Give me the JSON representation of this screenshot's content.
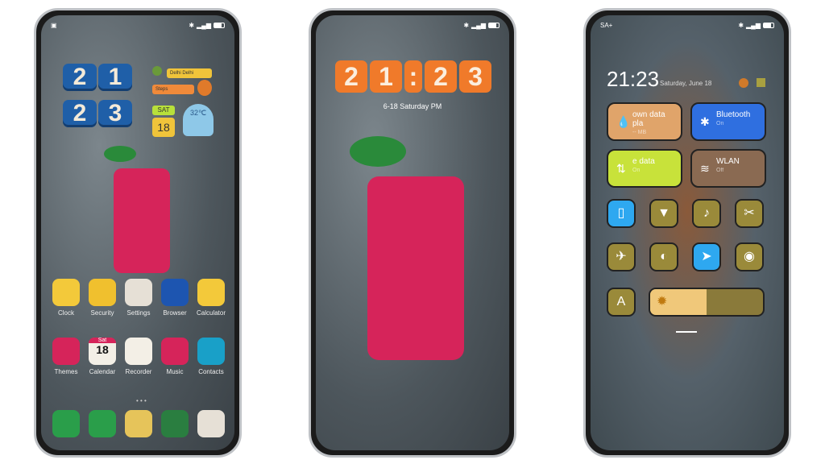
{
  "home": {
    "status_left": "▣",
    "clock_digits": [
      "2",
      "1",
      "2",
      "3"
    ],
    "location": "Delhi Delhi",
    "steps": "Steps",
    "day": "SAT",
    "date": "18",
    "temperature": "32℃",
    "apps_row1": [
      {
        "label": "Clock",
        "color": "#f3c93a"
      },
      {
        "label": "Security",
        "color": "#f0c02e"
      },
      {
        "label": "Settings",
        "color": "#e6e0d6"
      },
      {
        "label": "Browser",
        "color": "#1d55b0"
      },
      {
        "label": "Calculator",
        "color": "#f3c93a"
      }
    ],
    "apps_row2": [
      {
        "label": "Themes",
        "color": "#d6245a"
      },
      {
        "label": "Calendar",
        "color": "#f3efe6",
        "sub": "Sat",
        "date": "18"
      },
      {
        "label": "Recorder",
        "color": "#f3efe6"
      },
      {
        "label": "Music",
        "color": "#d6245a"
      },
      {
        "label": "Contacts",
        "color": "#19a0c8"
      }
    ],
    "dock": [
      {
        "name": "phone",
        "color": "#2a9e4a"
      },
      {
        "name": "messages",
        "color": "#2a9e4a"
      },
      {
        "name": "notes",
        "color": "#e6c45a"
      },
      {
        "name": "gallery",
        "color": "#2a7e40"
      },
      {
        "name": "camera",
        "color": "#e6e0d6"
      }
    ]
  },
  "lock": {
    "time": [
      "2",
      "1",
      ":",
      "2",
      "3"
    ],
    "date": "6-18 Saturday PM"
  },
  "control": {
    "carrier": "SA+",
    "time": "21:23",
    "date": "Saturday, June 18",
    "tiles": [
      {
        "title": "own data pla",
        "sub": "-- MB",
        "icon": "water-drop",
        "color": "#e0a46a"
      },
      {
        "title": "Bluetooth",
        "sub": "On",
        "icon": "bluetooth",
        "color": "#2f6fe0"
      },
      {
        "title": "e data",
        "sub": "On",
        "icon": "mobile-data",
        "color": "#c8e23a"
      },
      {
        "title": "WLAN",
        "sub": "Off",
        "icon": "wifi",
        "color": "#8a6a52"
      }
    ],
    "buttons": [
      {
        "icon": "vibrate",
        "glyph": "▯",
        "color": "#2ea8f0"
      },
      {
        "icon": "flashlight",
        "glyph": "▼",
        "color": "#9a8a3a"
      },
      {
        "icon": "bell",
        "glyph": "♪",
        "color": "#9a8a3a"
      },
      {
        "icon": "screenshot",
        "glyph": "✂",
        "color": "#9a8a3a"
      },
      {
        "icon": "airplane",
        "glyph": "✈",
        "color": "#9a8a3a"
      },
      {
        "icon": "dark-mode",
        "glyph": "◐",
        "color": "#9a8a3a"
      },
      {
        "icon": "location",
        "glyph": "➤",
        "color": "#2ea8f0"
      },
      {
        "icon": "eye",
        "glyph": "◉",
        "color": "#9a8a3a"
      }
    ],
    "auto_brightness": "A",
    "brightness": 0.5
  }
}
